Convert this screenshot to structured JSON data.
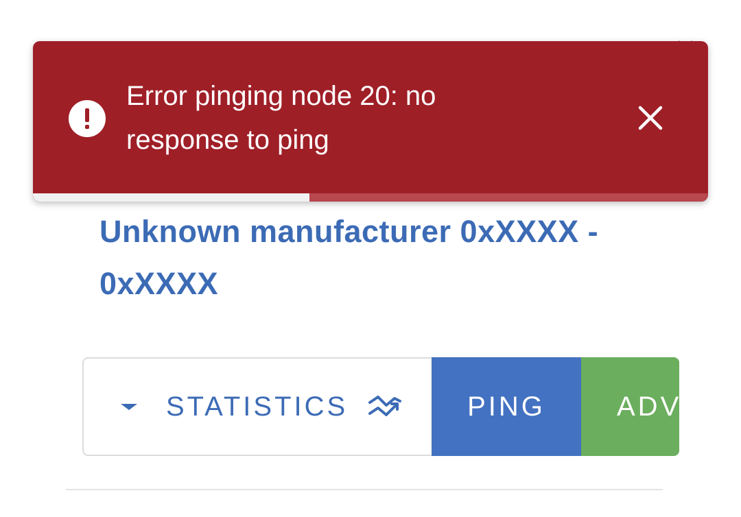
{
  "toast": {
    "message": "Error pinging node 20: no response to ping",
    "icon": "error-circle-icon",
    "close_icon": "close-icon",
    "progress": 0.41,
    "background_color": "#9f1f27"
  },
  "device": {
    "title": "Unknown manufacturer 0xXXXX - 0xXXXX"
  },
  "actions": {
    "statistics_label": "STATISTICS",
    "statistics_icon": "trending-icon",
    "ping_label": "PING",
    "advanced_label": "ADV"
  },
  "colors": {
    "accent": "#3c6bb5",
    "ping": "#4472c2",
    "advanced": "#6bae5e"
  }
}
